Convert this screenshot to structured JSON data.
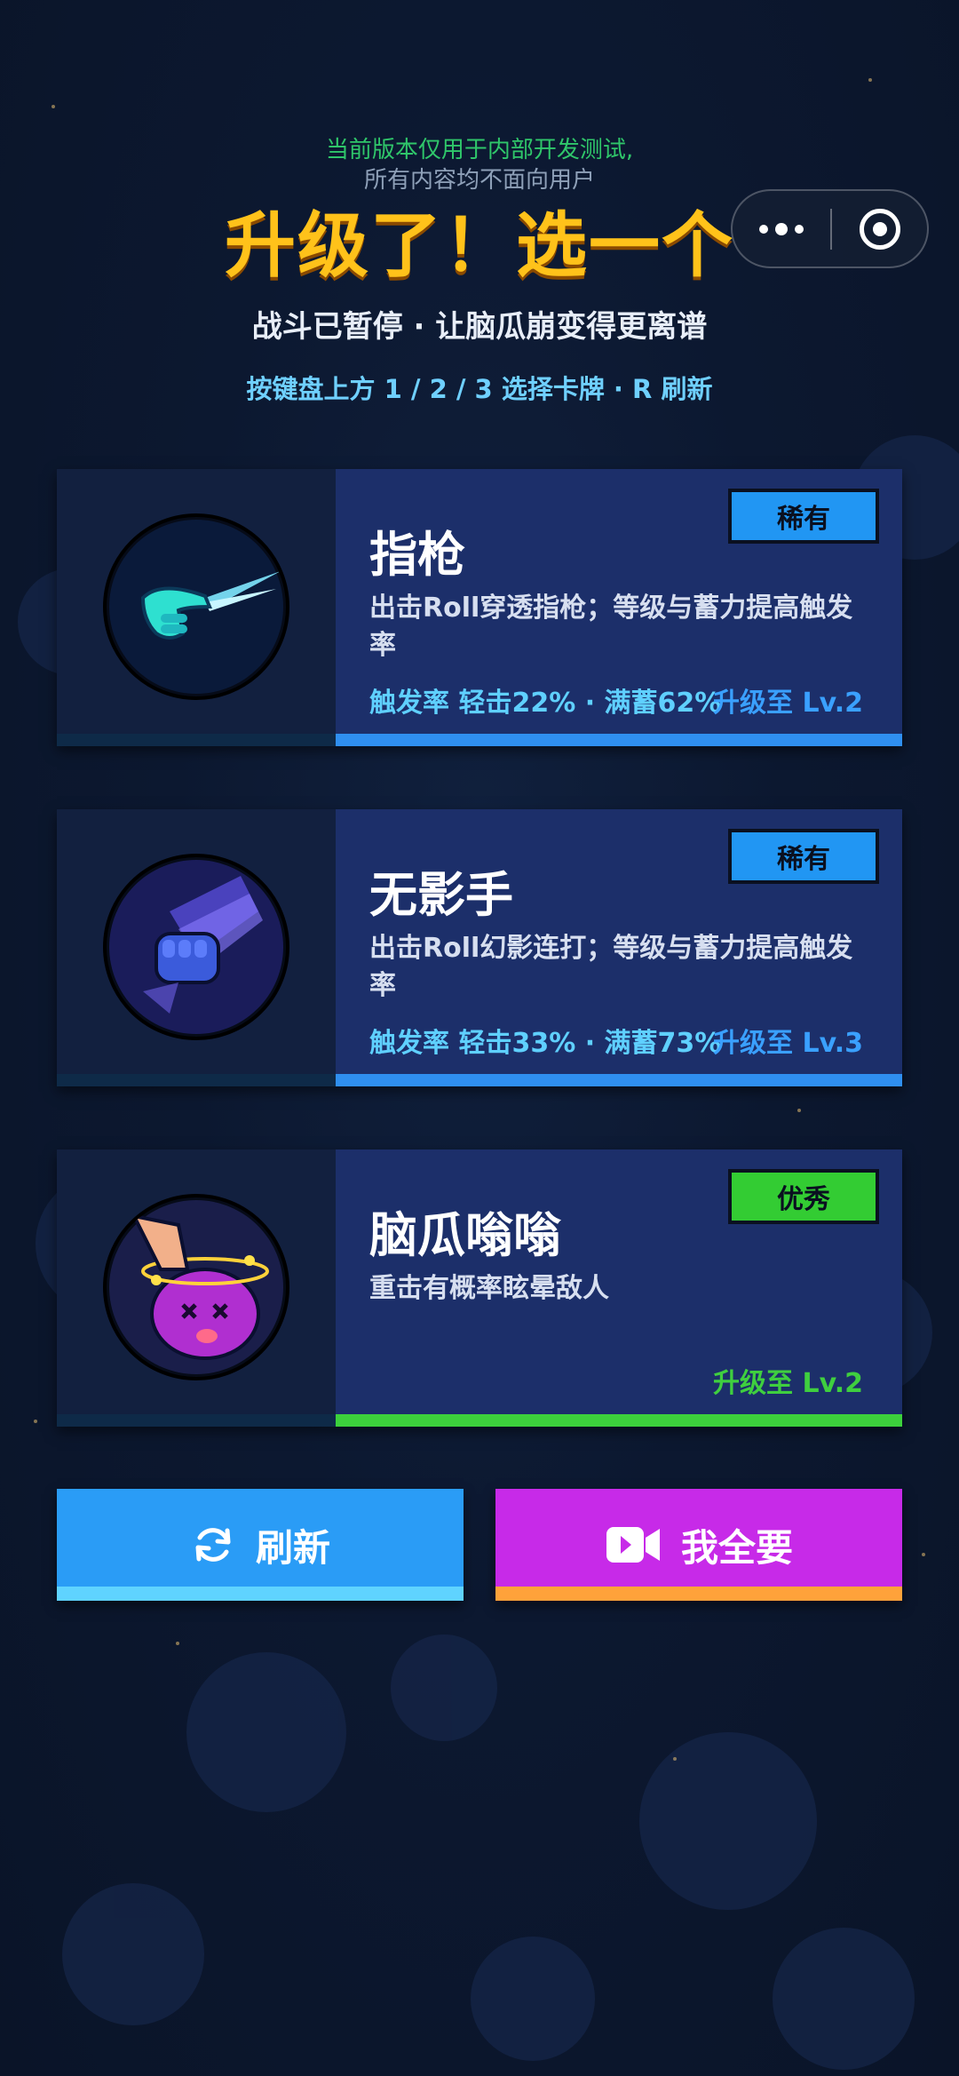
{
  "notice": {
    "line1": "当前版本仅用于内部开发测试,",
    "line2": "所有内容均不面向用户"
  },
  "title": "升级了！选一个",
  "subtitle": "战斗已暂停 · 让脑瓜崩变得更离谱",
  "hint": "按键盘上方 1 / 2 / 3 选择卡牌 · R 刷新",
  "capsule": {
    "more_icon": "more-dots-icon",
    "close_icon": "target-circle-icon"
  },
  "cards": [
    {
      "name": "指枪",
      "badge": "稀有",
      "badge_color": "#2196f3",
      "desc": "出击Roll穿透指枪；等级与蓄力提高触发率",
      "rate": "触发率 轻击22% · 满蓄62%",
      "upgrade": "升级至 Lv.2",
      "upgrade_color": "#3aa0ff",
      "bar_color": "#2f8ff0",
      "icon": "finger-gun-icon"
    },
    {
      "name": "无影手",
      "badge": "稀有",
      "badge_color": "#2196f3",
      "desc": "出击Roll幻影连打；等级与蓄力提高触发率",
      "rate": "触发率 轻击33% · 满蓄73%",
      "upgrade": "升级至 Lv.3",
      "upgrade_color": "#3aa0ff",
      "bar_color": "#2f8ff0",
      "icon": "phantom-fist-icon"
    },
    {
      "name": "脑瓜嗡嗡",
      "badge": "优秀",
      "badge_color": "#33cc33",
      "desc": "重击有概率眩晕敌人",
      "rate": "",
      "upgrade": "升级至 Lv.2",
      "upgrade_color": "#3fcf3f",
      "bar_color": "#3cd13c",
      "icon": "dizzy-head-icon"
    }
  ],
  "buttons": {
    "refresh": {
      "label": "刷新",
      "icon": "refresh-icon",
      "color": "#2a9cf6",
      "under": "#5fd3ff"
    },
    "take_all": {
      "label": "我全要",
      "icon": "video-camera-icon",
      "color": "#c72ae8",
      "under": "#ffa23a"
    }
  }
}
